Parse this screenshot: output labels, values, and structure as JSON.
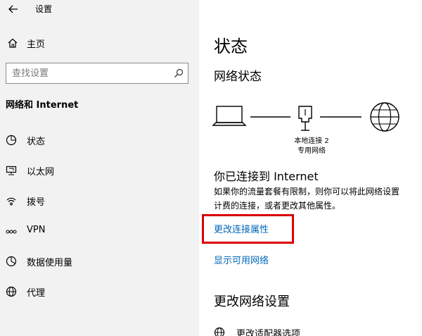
{
  "titlebar": {
    "back_icon": "back-arrow-icon",
    "title": "设置"
  },
  "sidebar": {
    "home": {
      "icon": "home-icon",
      "label": "主页"
    },
    "search": {
      "placeholder": "查找设置",
      "icon": "search-icon"
    },
    "section_heading": "网络和 Internet",
    "items": [
      {
        "icon": "status-icon",
        "label": "状态"
      },
      {
        "icon": "ethernet-icon",
        "label": "以太网"
      },
      {
        "icon": "dialup-icon",
        "label": "拨号"
      },
      {
        "icon": "vpn-icon",
        "label": "VPN"
      },
      {
        "icon": "data-usage-icon",
        "label": "数据使用量"
      },
      {
        "icon": "proxy-icon",
        "label": "代理"
      }
    ]
  },
  "main": {
    "page_title": "状态",
    "network_status_heading": "网络状态",
    "diagram": {
      "adapter_name": "本地连接 2",
      "adapter_profile": "专用网络"
    },
    "connected_heading": "你已连接到 Internet",
    "description_line1": "如果你的流量套餐有限制，则你可以将此网络设置",
    "description_line2": "计费的连接，或者更改其他属性。",
    "change_properties_link": "更改连接属性",
    "show_networks_link": "显示可用网络",
    "change_settings_heading": "更改网络设置",
    "adapter_options_label": "更改适配器选项"
  },
  "colors": {
    "sidebar_bg": "#f2f2f2",
    "link": "#0067b8",
    "highlight": "#d80000"
  }
}
